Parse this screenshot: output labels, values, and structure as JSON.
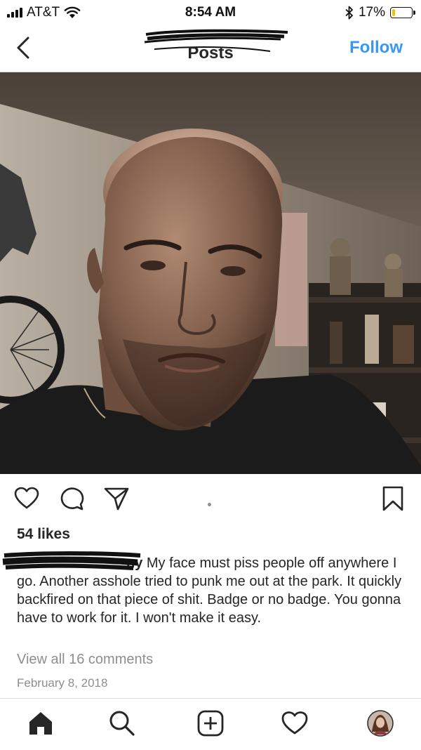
{
  "status_bar": {
    "carrier": "AT&T",
    "time": "8:54 AM",
    "battery": "17%",
    "battery_level": 0.17,
    "battery_color": "#f2c200"
  },
  "nav": {
    "title": "Posts",
    "follow_label": "Follow",
    "back_icon": "chevron-left-icon"
  },
  "post": {
    "likes": "54 likes",
    "caption_username": "ny",
    "caption_text": " My face must piss people off anywhere I go. Another asshole  tried to punk me out at the park.  It quickly backfired on that piece of shit. Badge or no badge. You gonna have to work for it. I won't make it easy.",
    "view_comments": "View all 16 comments",
    "date": "February 8, 2018"
  },
  "actions": {
    "icons": [
      "heart-icon",
      "comment-icon",
      "share-icon",
      "bookmark-icon"
    ]
  },
  "tab_bar": {
    "icons": [
      "home-icon",
      "search-icon",
      "new-post-icon",
      "activity-icon",
      "profile-avatar"
    ]
  },
  "colors": {
    "link": "#3897f0",
    "muted": "#8e8e8e",
    "text": "#262626",
    "divider": "#dbdbdb"
  }
}
